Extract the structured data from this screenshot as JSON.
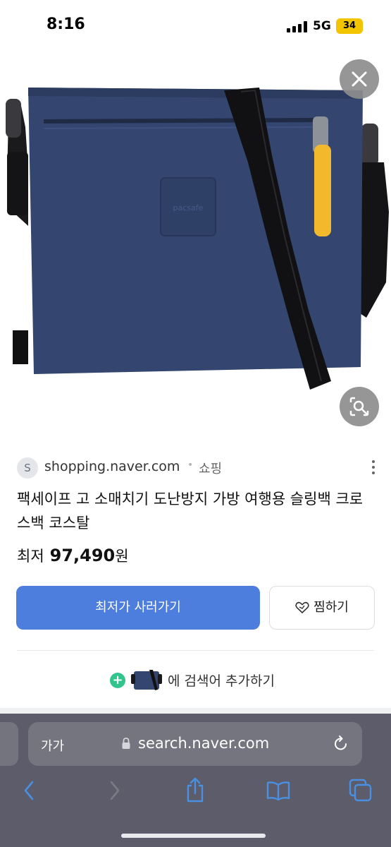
{
  "status_bar": {
    "time": "8:16",
    "network": "5G",
    "battery": "34",
    "battery_color": "#f2c500"
  },
  "image_viewer": {
    "close_icon": "close-icon",
    "lens_icon": "visual-search-icon",
    "brand_embossed_text": "pacsafe"
  },
  "result": {
    "favicon_letter": "S",
    "source_domain": "shopping.naver.com",
    "source_separator": "•",
    "source_category": "쇼핑",
    "title": "팩세이프 고 소매치기 도난방지 가방 여행용 슬링백 크로스백 코스탈",
    "price_label": "최저",
    "price_value": "97,490",
    "price_unit": "원",
    "buy_label": "최저가 사러가기",
    "wish_label": "찜하기",
    "add_search_label": "에 검색어 추가하기"
  },
  "browser": {
    "text_size_label": "가가",
    "url": "search.naver.com",
    "toolbar": [
      "back-icon",
      "forward-icon",
      "share-icon",
      "bookmarks-icon",
      "tabs-icon"
    ]
  },
  "colors": {
    "accent_button": "#4d7ddd",
    "bag_navy": "#34466f",
    "zipper_yellow": "#f2b92d",
    "add_green": "#32c48d"
  }
}
